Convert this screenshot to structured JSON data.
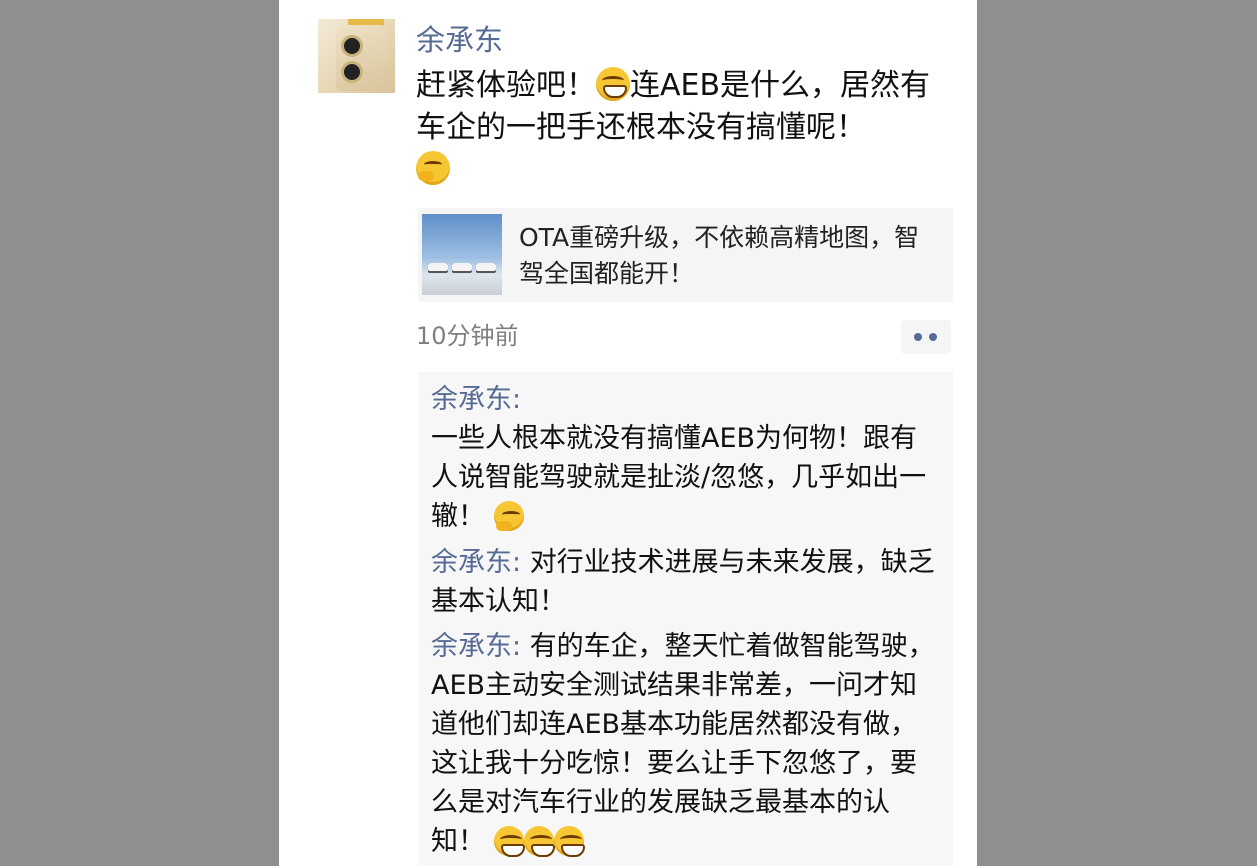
{
  "post": {
    "author": "余承东",
    "text_part1": "赶紧体验吧！",
    "text_part2": "连AEB是什么，居然有车企的一把手还根本没有搞懂呢！",
    "emoji_1": "grin-icon",
    "emoji_2": "thinking-icon",
    "timestamp": "10分钟前"
  },
  "link_card": {
    "title": "OTA重磅升级，不依赖高精地图，智驾全国都能开！"
  },
  "comments": [
    {
      "author": "余承东",
      "separator": ":",
      "text": "一些人根本就没有搞懂AEB为何物！跟有人说智能驾驶就是扯淡/忽悠，几乎如出一辙！",
      "emoji": "thinking-icon"
    },
    {
      "author": "余承东",
      "separator": ": ",
      "text": "对行业技术进展与未来发展，缺乏基本认知！"
    },
    {
      "author": "余承东",
      "separator": ": ",
      "text": "有的车企，整天忙着做智能驾驶，AEB主动安全测试结果非常差，一问才知道他们却连AEB基本功能居然都没有做，这让我十分吃惊！要么让手下忽悠了，要么是对汽车行业的发展缺乏最基本的认知！",
      "emoji": "grin-icon x3"
    }
  ]
}
